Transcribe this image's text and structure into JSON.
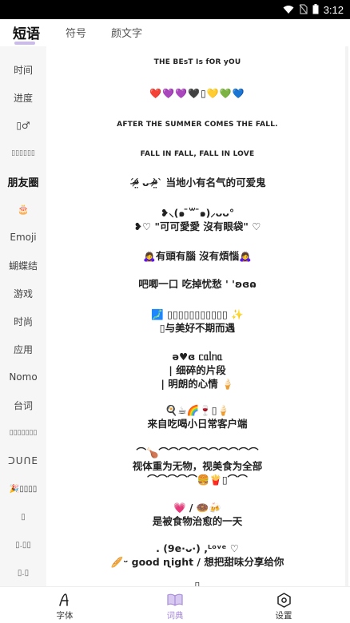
{
  "status_bar": {
    "time": "3:12"
  },
  "top_tabs": [
    {
      "label": "短语",
      "active": true
    },
    {
      "label": "符号",
      "active": false
    },
    {
      "label": "颜文字",
      "active": false
    }
  ],
  "sidebar": {
    "items": [
      {
        "label": "时间"
      },
      {
        "label": "进度"
      },
      {
        "label": "▯♂"
      },
      {
        "label": "▯▯▯▯▯▯"
      },
      {
        "label": "朋友圈",
        "active": true
      },
      {
        "label": "🎂"
      },
      {
        "label": "Emoji"
      },
      {
        "label": "蝴蝶结"
      },
      {
        "label": "游戏"
      },
      {
        "label": "时尚"
      },
      {
        "label": "应用"
      },
      {
        "label": "Nomo"
      },
      {
        "label": "台词"
      },
      {
        "label": "▯▯▯▯▯▯▯"
      },
      {
        "label": "ᑐᑌᑎE"
      },
      {
        "label": "🎉▯▯▯▯"
      },
      {
        "label": "▯"
      },
      {
        "label": "▯.▯▯"
      },
      {
        "label": "▯.▯"
      }
    ]
  },
  "phrases": [
    {
      "text": "THE  BEsT  Is  fOR  yOU"
    },
    {
      "text": "❤️💜💜🖤▯💛💚💙"
    },
    {
      "text": "AFTER THE SUMMER COMES THE FALL."
    },
    {
      "text": "FALL IN FALL, FALL IN LOVE"
    },
    {
      "text": "ˊᵒ̴̶̷̤́ ᴗ ᵒ̴̶̷̤̀ˋ 当地小有名气的可爱鬼"
    },
    {
      "text": "❥⸜(๑ ̄꒳ ̄๑)⸝ᴗᴗ°\n❥♡ \"可可愛愛 沒有眼袋\" ♡"
    },
    {
      "text": "🙇‍♀️有頭有腦 沒有煩惱🙇‍♀️"
    },
    {
      "text": "吧唧一口 吃掉忧愁 ' 'ʚɞɷ"
    },
    {
      "text": "🗾 ▯▯▯▯▯▯▯▯▯▯▯ ✨\n▯与美好不期而遇"
    },
    {
      "text": "ǝ♥ɞ ᥴᥲᥣᥒᥲ\n| 细碎的片段\n| 明朗的心情 🍦"
    },
    {
      "text": "🍳☕🌈🍷▯🍦\n来自吃喝小日常客户端"
    },
    {
      "text": "⌒🍗⌒⌒⌒⌒⌒⌒⌒⌒⌒⌒\n视体重为无物，视美食为全部\n⌒⌒⌒⌒⌒🍔🍟▯⌒⌒"
    },
    {
      "text": "💗 / 🍩🍻\n是被食物治愈的一天"
    },
    {
      "text": ". (9e·ᴗ·) ,ᴸᵒᵛᵉ ♡\n🥖ᵕ good ɳight / 想把甜味分享给你"
    },
    {
      "text": "▯"
    }
  ],
  "bottom_nav": [
    {
      "label": "字体",
      "icon": "font-A-icon",
      "active": false
    },
    {
      "label": "词典",
      "icon": "book-icon",
      "active": true
    },
    {
      "label": "设置",
      "icon": "settings-icon",
      "active": false
    }
  ],
  "colors": {
    "accent": "#a78bd8",
    "sidebar_bg": "#f6f6f6",
    "status_bar": "#000000"
  }
}
